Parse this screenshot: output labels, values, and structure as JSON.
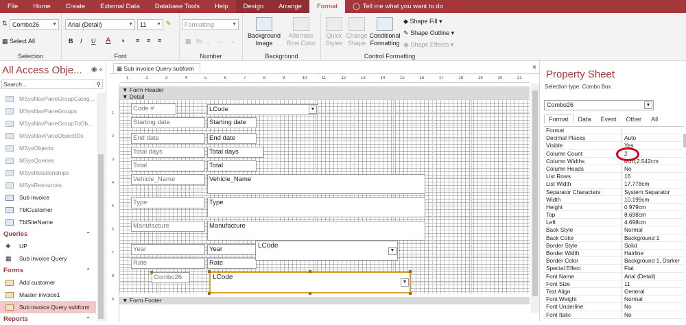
{
  "menu": {
    "file": "File",
    "home": "Home",
    "create": "Create",
    "external": "External Data",
    "dbtools": "Database Tools",
    "help": "Help",
    "design": "Design",
    "arrange": "Arrange",
    "format": "Format",
    "tell": "Tell me what you want to do"
  },
  "ribbon": {
    "selection": {
      "object": "Combo26",
      "select_all": "Select All",
      "label": "Selection"
    },
    "font": {
      "name": "Arial (Detail)",
      "size": "11",
      "bold": "B",
      "italic": "I",
      "underline": "U",
      "label": "Font"
    },
    "number": {
      "format": "Formatting",
      "percent": "%",
      "comma": ",",
      "label": "Number"
    },
    "background": {
      "bg_image1": "Background",
      "bg_image2": "Image",
      "alt_row1": "Alternate",
      "alt_row2": "Row Color",
      "label": "Background"
    },
    "control": {
      "quick1": "Quick",
      "quick2": "Styles",
      "change1": "Change",
      "change2": "Shape",
      "cond1": "Conditional",
      "cond2": "Formatting",
      "fill": "Shape Fill",
      "outline": "Shape Outline",
      "effects": "Shape Effects",
      "label": "Control Formatting"
    }
  },
  "nav": {
    "title": "All Access Obje...",
    "search": "Search...",
    "items": [
      {
        "label": "MSysNavPaneGroupCateg...",
        "dim": true
      },
      {
        "label": "MSysNavPaneGroups",
        "dim": true
      },
      {
        "label": "MSysNavPaneGroupToOb...",
        "dim": true
      },
      {
        "label": "MSysNavPaneObjectIDs",
        "dim": true
      },
      {
        "label": "MSysObjects",
        "dim": true
      },
      {
        "label": "MSysQueries",
        "dim": true
      },
      {
        "label": "MSysRelationships",
        "dim": true
      },
      {
        "label": "MSysResources",
        "dim": true
      },
      {
        "label": "Sub invoice",
        "dim": false
      },
      {
        "label": "TblCustomer",
        "dim": false
      },
      {
        "label": "TblSiteName",
        "dim": false
      }
    ],
    "queries_header": "Queries",
    "queries": [
      "UP",
      "Sub invoice Query"
    ],
    "forms_header": "Forms",
    "forms": [
      "Add customer",
      "Master invoice1",
      "Sub invoice Query subform"
    ],
    "reports_header": "Reports"
  },
  "doc": {
    "title": "Sub invoice Query subform",
    "close": "×",
    "form_header": "Form Header",
    "detail": "Detail",
    "form_footer": "Form Footer"
  },
  "ruler": [
    "1",
    "2",
    "3",
    "4",
    "5",
    "6",
    "7",
    "8",
    "9",
    "10",
    "11",
    "12",
    "13",
    "14",
    "15",
    "16",
    "17",
    "18",
    "19",
    "20",
    "21"
  ],
  "vruler": [
    "1",
    "2",
    "3",
    "4",
    "5",
    "6",
    "7",
    "8",
    "9"
  ],
  "form": {
    "labels": [
      "Code #",
      "Starting date",
      "End date",
      "Total days",
      "Total",
      "Vehicle_Name",
      "Type",
      "Manufacture",
      "Year",
      "Rate",
      "Combo26"
    ],
    "fields": [
      "LCode",
      "Starting date",
      "End date",
      "Total days",
      "Total",
      "Vehicle_Name",
      "Type",
      "Manufacture",
      "Year",
      "Rate"
    ],
    "combo_year": "LCode",
    "combo26": "LCode"
  },
  "property_sheet": {
    "title": "Property Sheet",
    "selection_type": "Selection type:  Combo Box",
    "object": "Combo26",
    "tabs": [
      "Format",
      "Data",
      "Event",
      "Other",
      "All"
    ],
    "rows": [
      [
        "Format",
        ""
      ],
      [
        "Decimal Places",
        "Auto"
      ],
      [
        "Visible",
        "Yes"
      ],
      [
        "Column Count",
        "2"
      ],
      [
        "Column Widths",
        "0cm;2.542cm"
      ],
      [
        "Column Heads",
        "No"
      ],
      [
        "List Rows",
        "16"
      ],
      [
        "List Width",
        "17.778cm"
      ],
      [
        "Separator Characters",
        "System Separator"
      ],
      [
        "Width",
        "10.199cm"
      ],
      [
        "Height",
        "0.979cm"
      ],
      [
        "Top",
        "8.698cm"
      ],
      [
        "Left",
        "4.698cm"
      ],
      [
        "Back Style",
        "Normal"
      ],
      [
        "Back Color",
        "Background 1"
      ],
      [
        "Border Style",
        "Solid"
      ],
      [
        "Border Width",
        "Hairline"
      ],
      [
        "Border Color",
        "Background 1, Darker"
      ],
      [
        "Special Effect",
        "Flat"
      ],
      [
        "Font Name",
        "Arial (Detail)"
      ],
      [
        "Font Size",
        "11"
      ],
      [
        "Text Align",
        "General"
      ],
      [
        "Font Weight",
        "Normal"
      ],
      [
        "Font Underline",
        "No"
      ],
      [
        "Font Italic",
        "No"
      ]
    ]
  }
}
